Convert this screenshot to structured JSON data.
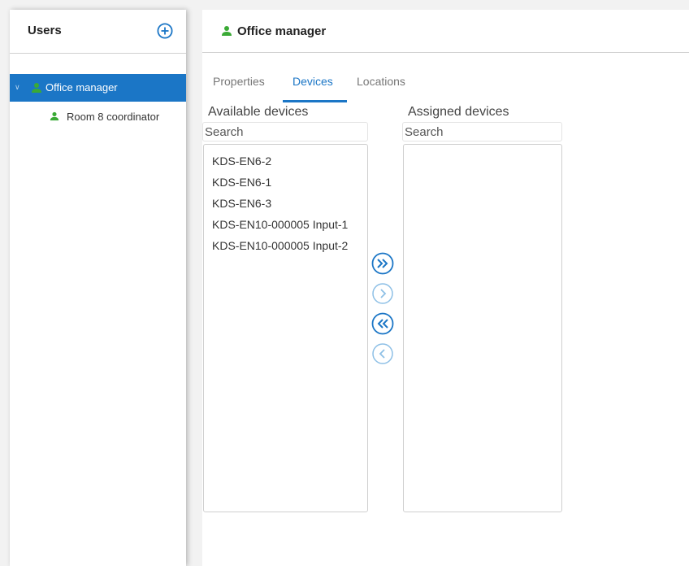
{
  "sidebar": {
    "title": "Users",
    "tree": {
      "selected_label": "Office manager",
      "child_label": "Room 8 coordinator"
    }
  },
  "main": {
    "title": "Office manager",
    "tabs": [
      {
        "label": "Properties",
        "active": false
      },
      {
        "label": "Devices",
        "active": true
      },
      {
        "label": "Locations",
        "active": false
      }
    ],
    "available": {
      "label": "Available devices",
      "search_placeholder": "Search",
      "items": [
        "KDS-EN6-2",
        "KDS-EN6-1",
        "KDS-EN6-3",
        "KDS-EN10-000005 Input-1",
        "KDS-EN10-000005 Input-2"
      ]
    },
    "assigned": {
      "label": "Assigned devices",
      "search_placeholder": "Search",
      "items": []
    }
  },
  "icons": {
    "add": "plus-circle-icon",
    "user": "user-icon",
    "move_all_right": "double-chevron-right-icon",
    "move_right": "chevron-right-icon",
    "move_all_left": "double-chevron-left-icon",
    "move_left": "chevron-left-icon"
  },
  "colors": {
    "accent": "#1b76c6",
    "user_icon": "#3aaa35",
    "disabled_button": "#8ec0e6"
  }
}
